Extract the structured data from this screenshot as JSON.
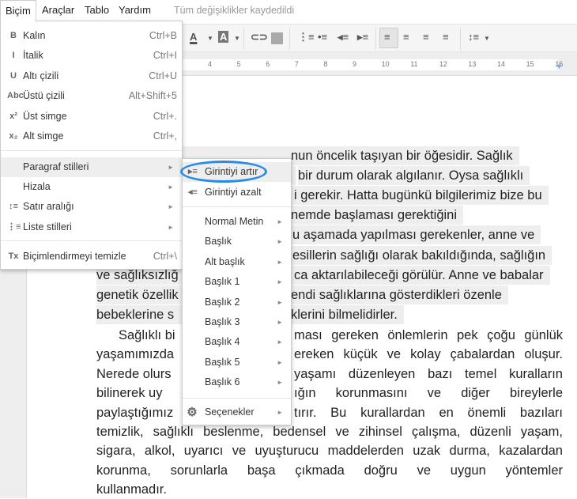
{
  "menubar": {
    "items": [
      "Biçim",
      "Araçlar",
      "Tablo",
      "Yardım"
    ],
    "status": "Tüm değişiklikler kaydedildi"
  },
  "ruler": {
    "numbers": [
      "4",
      "5",
      "6",
      "7",
      "8",
      "9",
      "10",
      "11",
      "12",
      "13",
      "14",
      "15",
      "16",
      "17"
    ]
  },
  "format_menu": {
    "items": [
      {
        "icon": "bold-icon",
        "glyph": "B",
        "label": "Kalın",
        "shortcut": "Ctrl+B"
      },
      {
        "icon": "italic-icon",
        "glyph": "I",
        "label": "İtalik",
        "shortcut": "Ctrl+I"
      },
      {
        "icon": "underline-icon",
        "glyph": "U",
        "label": "Altı çizili",
        "shortcut": "Ctrl+U"
      },
      {
        "icon": "strikethrough-icon",
        "glyph": "Abc",
        "label": "Üstü çizili",
        "shortcut": "Alt+Shift+5"
      },
      {
        "icon": "superscript-icon",
        "glyph": "x²",
        "label": "Üst simge",
        "shortcut": "Ctrl+."
      },
      {
        "icon": "subscript-icon",
        "glyph": "x₂",
        "label": "Alt simge",
        "shortcut": "Ctrl+,"
      },
      {
        "label": "Paragraf stilleri",
        "submenu": true,
        "highlighted": true
      },
      {
        "label": "Hizala",
        "submenu": true
      },
      {
        "icon": "line-spacing-icon",
        "glyph": "↕≡",
        "label": "Satır aralığı",
        "submenu": true
      },
      {
        "icon": "list-icon",
        "glyph": "⋮≡",
        "label": "Liste stilleri",
        "submenu": true
      },
      {
        "icon": "clear-formatting-icon",
        "glyph": "Tx",
        "label": "Biçimlendirmeyi temizle",
        "shortcut": "Ctrl+\\"
      }
    ]
  },
  "paragraph_submenu": {
    "indent_increase": "Girintiyi artır",
    "indent_decrease": "Girintiyi azalt",
    "styles": [
      "Normal Metin",
      "Başlık",
      "Alt başlık",
      "Başlık 1",
      "Başlık 2",
      "Başlık 3",
      "Başlık 4",
      "Başlık 5",
      "Başlık 6"
    ],
    "options": "Seçenekler",
    "highlight_color": "#2a8ae6"
  },
  "document": {
    "para1": [
      {
        "left": "",
        "right": "nun öncelik taşıyan bir öğesidir. Sağlık"
      },
      {
        "left": "",
        "right": "bir durum olarak algılanır. Oysa sağlıklı"
      },
      {
        "left": "",
        "right": "i gerekir. Hatta bugünkü bilgilerimiz bize bu"
      },
      {
        "left": "",
        "right": "nemde başlaması gerektiğini"
      },
      {
        "left": "",
        "right": "u aşamada yapılması gerekenler, anne ve"
      },
      {
        "left": "",
        "right": "esillerin sağlığı olarak bakıldığında, sağlığın"
      },
      {
        "left": "ve sağlıksızlığ",
        "right": "ca aktarılabileceği görülür. Anne ve babalar"
      },
      {
        "left": "genetik özellik",
        "right": "endi sağlıklarına gösterdikleri özenle"
      },
      {
        "left": "bebeklerine s",
        "right": "klerini bilmelidirler."
      }
    ],
    "para2": [
      {
        "left": "Sağlıklı bi",
        "right": "ması gereken önlemlerin pek çoğu günlük"
      },
      {
        "left": "yaşamımızda",
        "right": "ereken küçük ve kolay çabalardan oluşur."
      },
      {
        "left": "Nerede olurs",
        "right": "yaşamı düzenleyen bazı temel kuralların"
      },
      {
        "left": "bilinerek uy",
        "right": "ığın korunmasını ve diğer bireylerle"
      },
      {
        "left": "paylaştığımız",
        "right": "tırır. Bu kurallardan en önemli bazıları"
      },
      {
        "full": "temizlik, sağlıklı beslenme, bedensel ve zihinsel çalışma, düzenli yaşam,"
      },
      {
        "full": "sigara, alkol, uyarıcı ve uyuşturucu maddelerden uzak durma, kazalardan"
      },
      {
        "full": "korunma, sorunlarla başa çıkmada doğru ve uygun yöntemler"
      },
      {
        "last": "kullanmadır."
      }
    ]
  }
}
